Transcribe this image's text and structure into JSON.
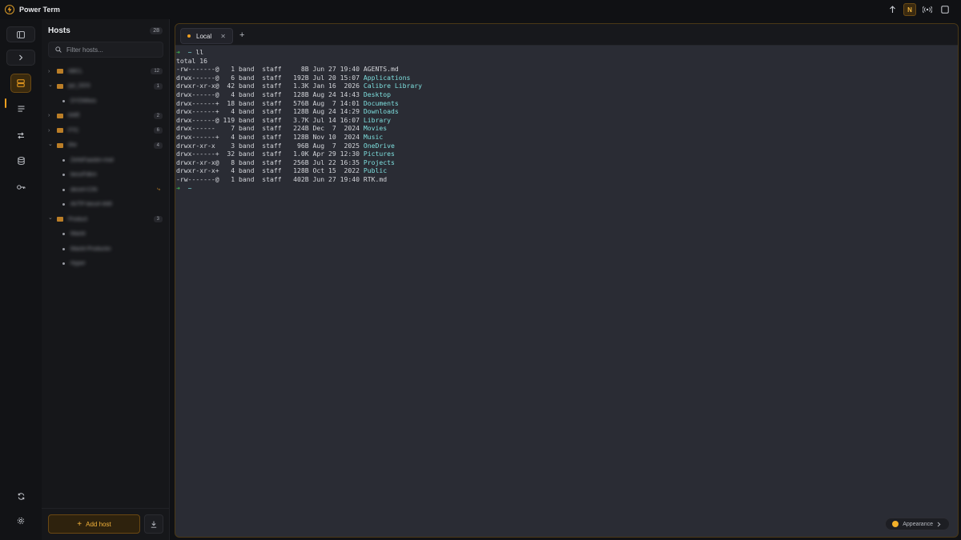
{
  "app": {
    "title": "Power Term"
  },
  "titlebar": {
    "avatar_initial": "N"
  },
  "sidebar": {
    "title": "Hosts",
    "count": "28",
    "filter_placeholder": "Filter hosts...",
    "add_host_label": "Add host",
    "tree": [
      {
        "type": "group",
        "expanded": false,
        "label": "ABCL",
        "count": "12"
      },
      {
        "type": "group",
        "expanded": true,
        "label": "pyl_DDS",
        "count": "1"
      },
      {
        "type": "child",
        "label": "DYDWkes"
      },
      {
        "type": "group",
        "expanded": false,
        "label": "kWE",
        "count": "2"
      },
      {
        "type": "group",
        "expanded": false,
        "label": "FTC",
        "count": "6"
      },
      {
        "type": "group",
        "expanded": true,
        "label": "ilhe",
        "count": "4"
      },
      {
        "type": "child",
        "label": "ZehkFaasbn-mwl"
      },
      {
        "type": "child",
        "label": "beuvFdkm"
      },
      {
        "type": "child",
        "label": "decerl-CIN",
        "flag": true
      },
      {
        "type": "child",
        "label": "AVTP-beuvf-AMI"
      },
      {
        "type": "group",
        "expanded": true,
        "label": "Product",
        "count": "3"
      },
      {
        "type": "child",
        "label": "Mackt"
      },
      {
        "type": "child",
        "label": "Mackt-Productin"
      },
      {
        "type": "child",
        "label": "Hyper"
      }
    ]
  },
  "tabs": [
    {
      "label": "Local"
    }
  ],
  "terminal": {
    "lines": [
      {
        "perm": "-rw-------@",
        "links": "1",
        "user": "band",
        "group": "staff",
        "size": "8B",
        "date": "Jun 27 19:40",
        "name": "AGENTS.md",
        "dir": false
      },
      {
        "perm": "drwx------@",
        "links": "6",
        "user": "band",
        "group": "staff",
        "size": "192B",
        "date": "Jul 20 15:07",
        "name": "Applications",
        "dir": true
      },
      {
        "perm": "drwxr-xr-x@",
        "links": "42",
        "user": "band",
        "group": "staff",
        "size": "1.3K",
        "date": "Jan 16  2026",
        "name": "Calibre Library",
        "dir": true
      },
      {
        "perm": "drwx------@",
        "links": "4",
        "user": "band",
        "group": "staff",
        "size": "128B",
        "date": "Aug 24 14:43",
        "name": "Desktop",
        "dir": true
      },
      {
        "perm": "drwx------+",
        "links": "18",
        "user": "band",
        "group": "staff",
        "size": "576B",
        "date": "Aug  7 14:01",
        "name": "Documents",
        "dir": true
      },
      {
        "perm": "drwx------+",
        "links": "4",
        "user": "band",
        "group": "staff",
        "size": "128B",
        "date": "Aug 24 14:29",
        "name": "Downloads",
        "dir": true
      },
      {
        "perm": "drwx------@",
        "links": "119",
        "user": "band",
        "group": "staff",
        "size": "3.7K",
        "date": "Jul 14 16:07",
        "name": "Library",
        "dir": true
      },
      {
        "perm": "drwx------",
        "links": "7",
        "user": "band",
        "group": "staff",
        "size": "224B",
        "date": "Dec  7  2024",
        "name": "Movies",
        "dir": true
      },
      {
        "perm": "drwx------+",
        "links": "4",
        "user": "band",
        "group": "staff",
        "size": "128B",
        "date": "Nov 10  2024",
        "name": "Music",
        "dir": true
      },
      {
        "perm": "drwxr-xr-x",
        "links": "3",
        "user": "band",
        "group": "staff",
        "size": "96B",
        "date": "Aug  7  2025",
        "name": "OneDrive",
        "dir": true
      },
      {
        "perm": "drwx------+",
        "links": "32",
        "user": "band",
        "group": "staff",
        "size": "1.0K",
        "date": "Apr 29 12:30",
        "name": "Pictures",
        "dir": true
      },
      {
        "perm": "drwxr-xr-x@",
        "links": "8",
        "user": "band",
        "group": "staff",
        "size": "256B",
        "date": "Jul 22 16:35",
        "name": "Projects",
        "dir": true
      },
      {
        "perm": "drwxr-xr-x+",
        "links": "4",
        "user": "band",
        "group": "staff",
        "size": "128B",
        "date": "Oct 15  2022",
        "name": "Public",
        "dir": true
      },
      {
        "perm": "-rw-------@",
        "links": "1",
        "user": "band",
        "group": "staff",
        "size": "402B",
        "date": "Jun 27 19:40",
        "name": "RTK.md",
        "dir": false
      }
    ]
  },
  "term_text": {
    "prompt_arrow": "➜",
    "home": "~",
    "command": "ll",
    "total": "total 16"
  },
  "appearance_label": "Appearance",
  "colors": {
    "accent": "#f0a020",
    "dir": "#7ee0df",
    "prompt": "#3fb950",
    "terminal_bg": "#2a2c34"
  },
  "icons": {
    "rail": [
      "sidebar-toggle-icon",
      "chevron-right-icon",
      "hosts-icon",
      "list-icon",
      "transfer-icon",
      "database-icon",
      "key-icon",
      "sync-icon",
      "settings-icon"
    ]
  }
}
